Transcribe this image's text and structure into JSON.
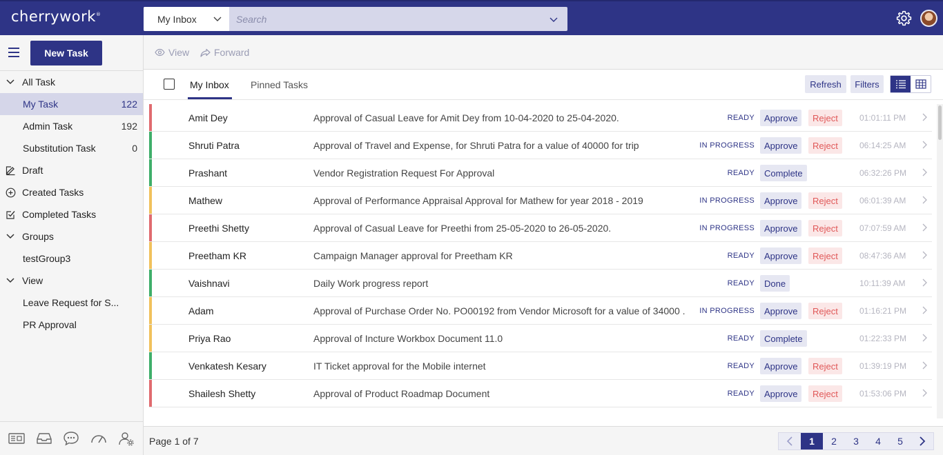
{
  "header": {
    "logo": "cherrywork",
    "logo_mark": "®",
    "scope_selected": "My Inbox",
    "search_placeholder": "Search"
  },
  "toolbar": {
    "new_task": "New Task",
    "view": "View",
    "forward": "Forward"
  },
  "sidebar": {
    "items": [
      {
        "label": "All Task",
        "count": "",
        "icon": "chevron-down-icon"
      },
      {
        "label": "My Task",
        "count": "122"
      },
      {
        "label": "Admin Task",
        "count": "192"
      },
      {
        "label": "Substitution Task",
        "count": "0"
      },
      {
        "label": "Draft",
        "count": "",
        "icon": "pencil-icon"
      },
      {
        "label": "Created Tasks",
        "count": "",
        "icon": "plus-circle-icon"
      },
      {
        "label": "Completed Tasks",
        "count": "",
        "icon": "check-box-icon"
      },
      {
        "label": "Groups",
        "count": "",
        "icon": "chevron-down-icon"
      },
      {
        "label": "testGroup3",
        "count": ""
      },
      {
        "label": "View",
        "count": "",
        "icon": "chevron-down-icon"
      },
      {
        "label": "Leave Request for S...",
        "count": ""
      },
      {
        "label": "PR Approval",
        "count": ""
      }
    ]
  },
  "tabs": {
    "inbox": "My Inbox",
    "pinned": "Pinned Tasks",
    "refresh": "Refresh",
    "filters": "Filters"
  },
  "tasks": [
    {
      "name": "Amit Dey",
      "subject": "Approval of Casual Leave for Amit Dey from 10-04-2020 to 25-04-2020.",
      "status": "READY",
      "action1": "Approve",
      "action2": "Reject",
      "time": "01:01:11 PM",
      "priority_color": "#e06b6f"
    },
    {
      "name": "Shruti Patra",
      "subject": "Approval of Travel and Expense, for Shruti Patra for a value of 40000 for trip",
      "status": "IN PROGRESS",
      "action1": "Approve",
      "action2": "Reject",
      "time": "06:14:25 AM",
      "priority_color": "#3fae6a"
    },
    {
      "name": "Prashant",
      "subject": "Vendor Registration Request For Approval",
      "status": "READY",
      "action1": "Complete",
      "action2": "",
      "time": "06:32:26 PM",
      "priority_color": "#3fae6a"
    },
    {
      "name": "Mathew",
      "subject": "Approval of Performance Appraisal Approval for Mathew for year 2018 - 2019",
      "status": "IN PROGRESS",
      "action1": "Approve",
      "action2": "Reject",
      "time": "06:01:39 AM",
      "priority_color": "#f1c15c"
    },
    {
      "name": "Preethi Shetty",
      "subject": "Approval of Casual Leave for Preethi from 25-05-2020 to 26-05-2020.",
      "status": "IN PROGRESS",
      "action1": "Approve",
      "action2": "Reject",
      "time": "07:07:59 AM",
      "priority_color": "#e06b6f"
    },
    {
      "name": "Preetham KR",
      "subject": "Campaign Manager approval for Preetham KR",
      "status": "READY",
      "action1": "Approve",
      "action2": "Reject",
      "time": "08:47:36 AM",
      "priority_color": "#f1c15c"
    },
    {
      "name": "Vaishnavi",
      "subject": "Daily Work progress report",
      "status": "READY",
      "action1": "Done",
      "action2": "",
      "time": "10:11:39 AM",
      "priority_color": "#3fae6a"
    },
    {
      "name": "Adam",
      "subject": "Approval of Purchase Order No. PO00192 from Vendor Microsoft for a value of 34000 .",
      "status": "IN PROGRESS",
      "action1": "Approve",
      "action2": "Reject",
      "time": "01:16:21 PM",
      "priority_color": "#f1c15c"
    },
    {
      "name": "Priya Rao",
      "subject": "Approval of Incture Workbox Document 11.0",
      "status": "READY",
      "action1": "Complete",
      "action2": "",
      "time": "01:22:33 PM",
      "priority_color": "#f1c15c"
    },
    {
      "name": "Venkatesh Kesary",
      "subject": "IT Ticket approval for the Mobile internet",
      "status": "READY",
      "action1": "Approve",
      "action2": "Reject",
      "time": "01:39:19 PM",
      "priority_color": "#3fae6a"
    },
    {
      "name": "Shailesh Shetty",
      "subject": "Approval of Product Roadmap Document",
      "status": "READY",
      "action1": "Approve",
      "action2": "Reject",
      "time": "01:53:06 PM",
      "priority_color": "#e06b6f"
    }
  ],
  "footer": {
    "page_info": "Page 1 of 7",
    "pages": [
      "1",
      "2",
      "3",
      "4",
      "5"
    ]
  }
}
